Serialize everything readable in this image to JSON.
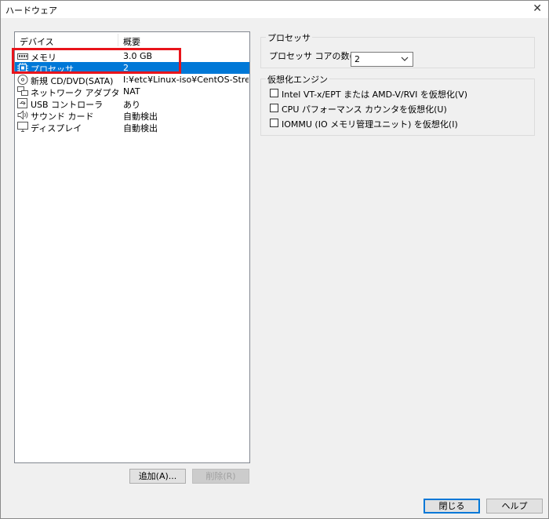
{
  "window": {
    "title": "ハードウェア",
    "close_glyph": "✕"
  },
  "device_list": {
    "columns": [
      "デバイス",
      "概要"
    ],
    "rows": [
      {
        "icon": "memory-icon",
        "name": "メモリ",
        "summary": "3.0 GB",
        "selected": false
      },
      {
        "icon": "processor-icon",
        "name": "プロセッサ",
        "summary": "2",
        "selected": true
      },
      {
        "icon": "cd-dvd-icon",
        "name": "新規 CD/DVD(SATA)",
        "summary": "I:¥etc¥Linux-iso¥CentOS-Strea...",
        "selected": false
      },
      {
        "icon": "network-adapter-icon",
        "name": "ネットワーク アダプタ",
        "summary": "NAT",
        "selected": false
      },
      {
        "icon": "usb-controller-icon",
        "name": "USB コントローラ",
        "summary": "あり",
        "selected": false
      },
      {
        "icon": "sound-card-icon",
        "name": "サウンド カード",
        "summary": "自動検出",
        "selected": false
      },
      {
        "icon": "display-icon",
        "name": "ディスプレイ",
        "summary": "自動検出",
        "selected": false
      }
    ],
    "highlight_color": "#e8141b",
    "selection_color": "#0078d7"
  },
  "buttons": {
    "add": "追加(A)...",
    "remove": "削除(R)",
    "close": "閉じる",
    "help": "ヘルプ"
  },
  "processor": {
    "group_title": "プロセッサ",
    "cores_label": "プロセッサ コアの数(C):",
    "cores_value": "2"
  },
  "virtualization": {
    "group_title": "仮想化エンジン",
    "options": [
      {
        "label": "Intel VT-x/EPT または AMD-V/RVI を仮想化(V)",
        "checked": false
      },
      {
        "label": "CPU パフォーマンス カウンタを仮想化(U)",
        "checked": false
      },
      {
        "label": "IOMMU (IO メモリ管理ユニット) を仮想化(I)",
        "checked": false
      }
    ]
  }
}
